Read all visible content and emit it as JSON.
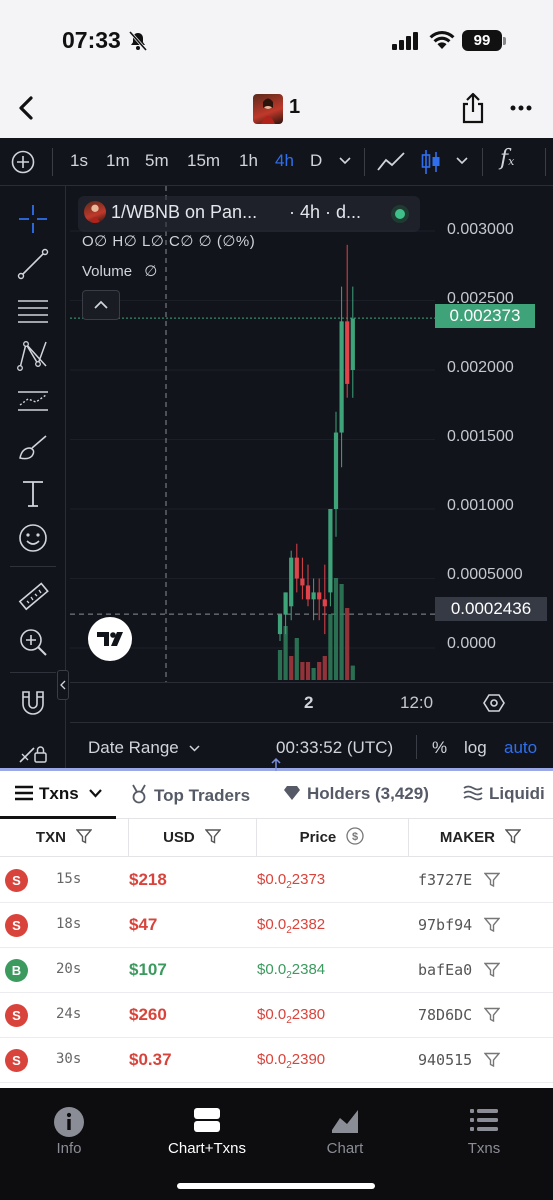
{
  "status": {
    "time": "07:33",
    "battery": "99"
  },
  "header": {
    "title": "1"
  },
  "chart_toolbar": {
    "intervals": [
      "1s",
      "1m",
      "5m",
      "15m",
      "1h",
      "4h",
      "D"
    ],
    "active_interval": "4h",
    "fx_label": "f"
  },
  "chart_info": {
    "symbol": "1/WBNB on Pan...",
    "interval_text": "· 4h · d...",
    "ohlc_text": "O∅ H∅ L∅ C∅ ∅ (∅%)",
    "volume_label": "Volume",
    "volume_value": "∅"
  },
  "chart_data": {
    "type": "candlestick",
    "title": "1/WBNB on Pan...",
    "y_ticks": [
      "0.003000",
      "0.002500",
      "0.002000",
      "0.001500",
      "0.001000",
      "0.0005000",
      "0.0000"
    ],
    "ylim": [
      0,
      0.003
    ],
    "x_ticks": [
      "2",
      "12:0"
    ],
    "last_price": "0.002373",
    "crosshair_price": "0.0002436",
    "candles": [
      {
        "o": 0.0001,
        "h": 0.00022,
        "l": 5e-05,
        "c": 0.00024,
        "up": true
      },
      {
        "o": 0.00024,
        "h": 0.0004,
        "l": 0.0001,
        "c": 0.0004,
        "up": true
      },
      {
        "o": 0.0003,
        "h": 0.0007,
        "l": 0.0002,
        "c": 0.00065,
        "up": true
      },
      {
        "o": 0.00065,
        "h": 0.00075,
        "l": 0.0004,
        "c": 0.0005,
        "up": false
      },
      {
        "o": 0.0005,
        "h": 0.00065,
        "l": 0.00035,
        "c": 0.00045,
        "up": false
      },
      {
        "o": 0.00045,
        "h": 0.0006,
        "l": 0.0003,
        "c": 0.00035,
        "up": false
      },
      {
        "o": 0.00035,
        "h": 0.0005,
        "l": 0.0002,
        "c": 0.0004,
        "up": true
      },
      {
        "o": 0.0004,
        "h": 0.0005,
        "l": 0.0002,
        "c": 0.00035,
        "up": false
      },
      {
        "o": 0.00035,
        "h": 0.0006,
        "l": 0.0001,
        "c": 0.0003,
        "up": false
      },
      {
        "o": 0.0004,
        "h": 0.001,
        "l": 0.0003,
        "c": 0.001,
        "up": true
      },
      {
        "o": 0.001,
        "h": 0.0017,
        "l": 0.0008,
        "c": 0.00155,
        "up": true
      },
      {
        "o": 0.00155,
        "h": 0.0026,
        "l": 0.0013,
        "c": 0.00235,
        "up": true
      },
      {
        "o": 0.00235,
        "h": 0.0029,
        "l": 0.0018,
        "c": 0.0019,
        "up": false
      },
      {
        "o": 0.002,
        "h": 0.0026,
        "l": 0.0018,
        "c": 0.00237,
        "up": true
      }
    ],
    "volumes": [
      {
        "v": 0.25,
        "up": true
      },
      {
        "v": 0.45,
        "up": true
      },
      {
        "v": 0.2,
        "up": false
      },
      {
        "v": 0.35,
        "up": true
      },
      {
        "v": 0.15,
        "up": false
      },
      {
        "v": 0.15,
        "up": false
      },
      {
        "v": 0.1,
        "up": true
      },
      {
        "v": 0.15,
        "up": false
      },
      {
        "v": 0.2,
        "up": false
      },
      {
        "v": 0.55,
        "up": true
      },
      {
        "v": 0.85,
        "up": true
      },
      {
        "v": 0.8,
        "up": true
      },
      {
        "v": 0.6,
        "up": false
      },
      {
        "v": 0.12,
        "up": true
      }
    ]
  },
  "chart_bottom": {
    "date_range": "Date Range",
    "clock": "00:33:52 (UTC)",
    "percent": "%",
    "log": "log",
    "auto": "auto"
  },
  "tabs": [
    {
      "label": "Txns"
    },
    {
      "label": "Top Traders"
    },
    {
      "label": "Holders (3,429)"
    },
    {
      "label": "Liquidi"
    }
  ],
  "table": {
    "headers": [
      "TXN",
      "USD",
      "Price",
      "MAKER"
    ],
    "rows": [
      {
        "type": "S",
        "age": "15s",
        "usd": "$218",
        "price_prefix": "$0.0",
        "price_sub": "2",
        "price_suffix": "2373",
        "maker": "f3727E"
      },
      {
        "type": "S",
        "age": "18s",
        "usd": "$47",
        "price_prefix": "$0.0",
        "price_sub": "2",
        "price_suffix": "2382",
        "maker": "97bf94"
      },
      {
        "type": "B",
        "age": "20s",
        "usd": "$107",
        "price_prefix": "$0.0",
        "price_sub": "2",
        "price_suffix": "2384",
        "maker": "bafEa0"
      },
      {
        "type": "S",
        "age": "24s",
        "usd": "$260",
        "price_prefix": "$0.0",
        "price_sub": "2",
        "price_suffix": "2380",
        "maker": "78D6DC"
      },
      {
        "type": "S",
        "age": "30s",
        "usd": "$0.37",
        "price_prefix": "$0.0",
        "price_sub": "2",
        "price_suffix": "2390",
        "maker": "940515"
      }
    ]
  },
  "bottom_nav": [
    {
      "label": "Info"
    },
    {
      "label": "Chart+Txns"
    },
    {
      "label": "Chart"
    },
    {
      "label": "Txns"
    }
  ],
  "colors": {
    "up": "#3fa37a",
    "down": "#e0434a",
    "sell_badge": "#d8443b",
    "buy_badge": "#3c9a5f",
    "accent": "#2f6fef"
  }
}
